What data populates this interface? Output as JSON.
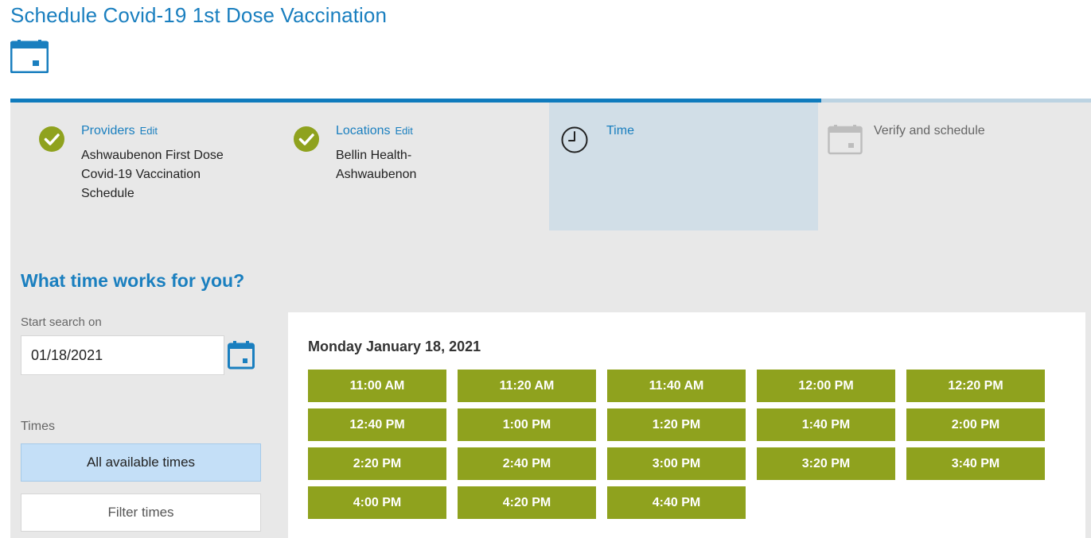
{
  "page": {
    "title": "Schedule Covid-19 1st Dose Vaccination"
  },
  "progress": {
    "fraction": 0.75
  },
  "steps": [
    {
      "title": "Providers",
      "edit": "Edit",
      "detail": "Ashwaubenon First Dose Covid-19 Vaccination Schedule",
      "status": "done"
    },
    {
      "title": "Locations",
      "edit": "Edit",
      "detail": "Bellin Health-Ashwaubenon",
      "status": "done"
    },
    {
      "title": "Time",
      "status": "active"
    },
    {
      "title": "Verify and schedule",
      "status": "pending"
    }
  ],
  "section": {
    "heading": "What time works for you?"
  },
  "search": {
    "start_label": "Start search on",
    "start_value": "01/18/2021"
  },
  "times": {
    "label": "Times",
    "all_label": "All available times",
    "filter_label": "Filter times"
  },
  "day": {
    "heading": "Monday January 18, 2021",
    "slots": [
      "11:00 AM",
      "11:20 AM",
      "11:40 AM",
      "12:00 PM",
      "12:20 PM",
      "12:40 PM",
      "1:00 PM",
      "1:20 PM",
      "1:40 PM",
      "2:00 PM",
      "2:20 PM",
      "2:40 PM",
      "3:00 PM",
      "3:20 PM",
      "3:40 PM",
      "4:00 PM",
      "4:20 PM",
      "4:40 PM"
    ]
  },
  "colors": {
    "accent": "#1a7fbf",
    "check": "#8fa21e",
    "slot": "#8fa21e",
    "active_step": "#d1dee7",
    "selected_filter": "#c4dff7"
  },
  "icons": {
    "title": "calendar-icon",
    "done": "check-circle-icon",
    "time": "clock-icon",
    "pending": "calendar-icon"
  }
}
